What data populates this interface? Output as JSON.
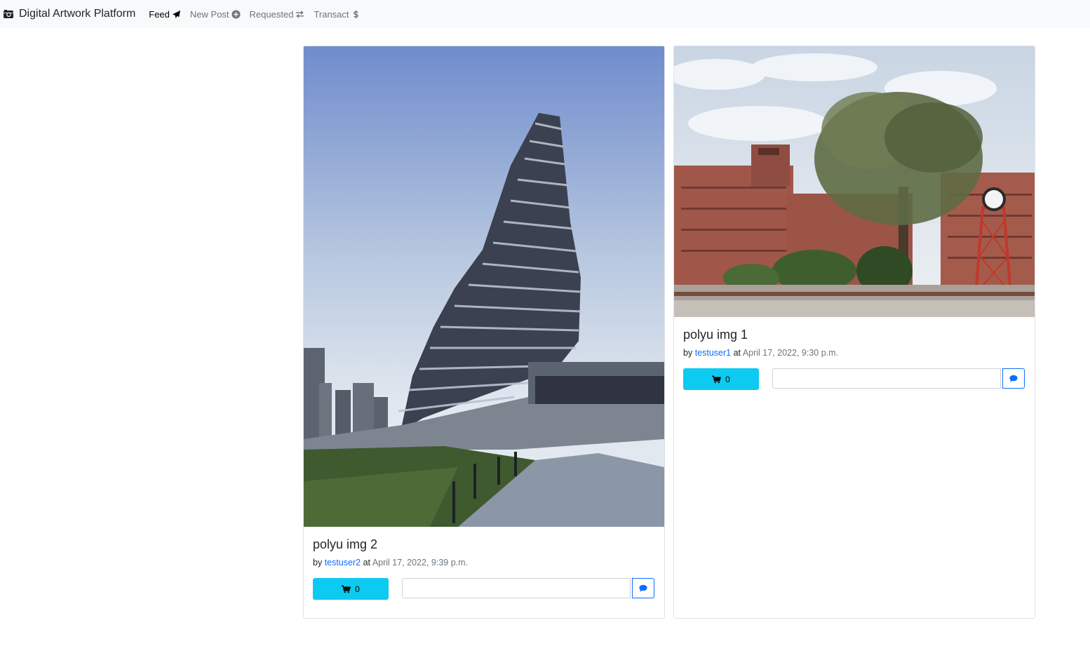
{
  "navbar": {
    "brand": "Digital Artwork Platform",
    "brand_icon": "camera-retro-icon",
    "items": [
      {
        "label": "Feed",
        "icon": "paper-plane-icon",
        "active": true
      },
      {
        "label": "New Post",
        "icon": "plus-circle-icon",
        "active": false
      },
      {
        "label": "Requested",
        "icon": "exchange-arrows-icon",
        "active": false
      },
      {
        "label": "Transact",
        "icon": "dollar-icon",
        "active": false
      }
    ]
  },
  "posts": [
    {
      "title": "polyu img 2",
      "by": "by",
      "author": "testuser2",
      "at": "at",
      "date": "April 17, 2022, 9:39 p.m.",
      "buy_count": "0",
      "comment_placeholder": ""
    },
    {
      "title": "polyu img 1",
      "by": "by",
      "author": "testuser1",
      "at": "at",
      "date": "April 17, 2022, 9:30 p.m.",
      "buy_count": "0",
      "comment_placeholder": ""
    }
  ],
  "colors": {
    "navbar_bg": "#f8f9fa",
    "info_button": "#0dcaf0",
    "link": "#0d6efd",
    "muted": "#6c757d"
  }
}
